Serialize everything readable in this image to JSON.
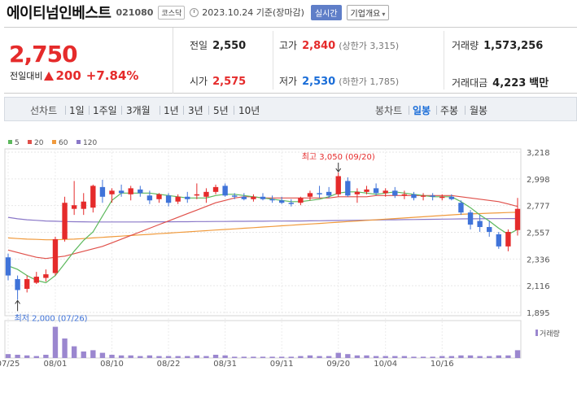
{
  "header": {
    "stock_name": "에이티넘인베스트",
    "stock_code": "021080",
    "market_badge": "코스닥",
    "base_date": "2023.10.24 기준(장마감)",
    "realtime_button": "실시간",
    "company_menu": "기업개요",
    "company_menu_caret": "▾"
  },
  "summary": {
    "price": "2,750",
    "change_label": "전일대비",
    "change_value": "200",
    "change_percent": "+7.84%",
    "prev_close_label": "전일",
    "prev_close": "2,550",
    "open_label": "시가",
    "open": "2,575",
    "high_label": "고가",
    "high": "2,840",
    "upper_limit": "(상한가 3,315)",
    "low_label": "저가",
    "low": "2,530",
    "lower_limit": "(하한가 1,785)",
    "volume_label": "거래량",
    "volume": "1,573,256",
    "amount_label": "거래대금",
    "amount": "4,223",
    "amount_unit": "백만",
    "up_color": "#e52b2b",
    "down_color": "#1a6dd8"
  },
  "toolbar": {
    "line_label": "선차트",
    "line_periods": [
      "1일",
      "1주일",
      "3개월",
      "1년",
      "3년",
      "5년",
      "10년"
    ],
    "candle_label": "봉차트",
    "candle_periods": [
      "일봉",
      "주봉",
      "월봉"
    ],
    "active_candle": "일봉"
  },
  "chart_data": {
    "type": "candlestick",
    "y_ticks": [
      "3,218",
      "2,998",
      "2,777",
      "2,557",
      "2,336",
      "2,116",
      "1,895"
    ],
    "ylim": [
      1895,
      3218
    ],
    "x_ticks": [
      {
        "i": 0,
        "label": "07/25"
      },
      {
        "i": 5,
        "label": "08/01"
      },
      {
        "i": 11,
        "label": "08/10"
      },
      {
        "i": 17,
        "label": "08/22"
      },
      {
        "i": 23,
        "label": "08/31"
      },
      {
        "i": 29,
        "label": "09/11"
      },
      {
        "i": 35,
        "label": "09/20"
      },
      {
        "i": 40,
        "label": "10/04"
      },
      {
        "i": 46,
        "label": "10/16"
      }
    ],
    "legend": [
      {
        "name": "5",
        "color": "#5cb85c"
      },
      {
        "name": "20",
        "color": "#e0504a"
      },
      {
        "name": "60",
        "color": "#f09a3c"
      },
      {
        "name": "120",
        "color": "#8a78c8"
      }
    ],
    "volume_label": "거래량",
    "high_annotation": "최고 3,050 (09/20)",
    "low_annotation": "최저 2,000 (07/26)",
    "up_color": "#e52b2b",
    "down_color": "#3f73d9",
    "volume_color": "#9b87cf",
    "candles": [
      {
        "o": 2350,
        "h": 2380,
        "l": 2160,
        "c": 2200,
        "v": 6
      },
      {
        "o": 2170,
        "h": 2200,
        "l": 2000,
        "c": 2080,
        "v": 5
      },
      {
        "o": 2090,
        "h": 2200,
        "l": 2060,
        "c": 2170,
        "v": 4
      },
      {
        "o": 2140,
        "h": 2230,
        "l": 2130,
        "c": 2190,
        "v": 3
      },
      {
        "o": 2180,
        "h": 2250,
        "l": 2150,
        "c": 2210,
        "v": 5
      },
      {
        "o": 2220,
        "h": 2520,
        "l": 2200,
        "c": 2500,
        "v": 48
      },
      {
        "o": 2500,
        "h": 2850,
        "l": 2480,
        "c": 2800,
        "v": 30
      },
      {
        "o": 2750,
        "h": 2980,
        "l": 2700,
        "c": 2780,
        "v": 18
      },
      {
        "o": 2750,
        "h": 2880,
        "l": 2700,
        "c": 2810,
        "v": 10
      },
      {
        "o": 2760,
        "h": 2950,
        "l": 2720,
        "c": 2940,
        "v": 12
      },
      {
        "o": 2930,
        "h": 2990,
        "l": 2800,
        "c": 2850,
        "v": 8
      },
      {
        "o": 2870,
        "h": 2920,
        "l": 2800,
        "c": 2900,
        "v": 5
      },
      {
        "o": 2900,
        "h": 2950,
        "l": 2850,
        "c": 2880,
        "v": 4
      },
      {
        "o": 2870,
        "h": 2940,
        "l": 2820,
        "c": 2920,
        "v": 4
      },
      {
        "o": 2910,
        "h": 2940,
        "l": 2850,
        "c": 2880,
        "v": 3
      },
      {
        "o": 2860,
        "h": 2900,
        "l": 2790,
        "c": 2820,
        "v": 4
      },
      {
        "o": 2830,
        "h": 2880,
        "l": 2800,
        "c": 2870,
        "v": 3
      },
      {
        "o": 2860,
        "h": 2880,
        "l": 2770,
        "c": 2800,
        "v": 3
      },
      {
        "o": 2810,
        "h": 2870,
        "l": 2790,
        "c": 2850,
        "v": 3
      },
      {
        "o": 2850,
        "h": 2890,
        "l": 2800,
        "c": 2830,
        "v": 3
      },
      {
        "o": 2860,
        "h": 2960,
        "l": 2830,
        "c": 2870,
        "v": 4
      },
      {
        "o": 2850,
        "h": 2920,
        "l": 2800,
        "c": 2890,
        "v": 3
      },
      {
        "o": 2890,
        "h": 2950,
        "l": 2870,
        "c": 2930,
        "v": 5
      },
      {
        "o": 2940,
        "h": 2960,
        "l": 2850,
        "c": 2860,
        "v": 4
      },
      {
        "o": 2860,
        "h": 2880,
        "l": 2830,
        "c": 2850,
        "v": 2
      },
      {
        "o": 2850,
        "h": 2880,
        "l": 2820,
        "c": 2830,
        "v": 2
      },
      {
        "o": 2830,
        "h": 2870,
        "l": 2810,
        "c": 2850,
        "v": 2
      },
      {
        "o": 2850,
        "h": 2880,
        "l": 2820,
        "c": 2830,
        "v": 2
      },
      {
        "o": 2830,
        "h": 2860,
        "l": 2800,
        "c": 2820,
        "v": 2
      },
      {
        "o": 2820,
        "h": 2850,
        "l": 2790,
        "c": 2800,
        "v": 2
      },
      {
        "o": 2800,
        "h": 2830,
        "l": 2770,
        "c": 2790,
        "v": 2
      },
      {
        "o": 2800,
        "h": 2850,
        "l": 2780,
        "c": 2840,
        "v": 3
      },
      {
        "o": 2850,
        "h": 2900,
        "l": 2820,
        "c": 2880,
        "v": 4
      },
      {
        "o": 2880,
        "h": 2940,
        "l": 2840,
        "c": 2870,
        "v": 3
      },
      {
        "o": 2890,
        "h": 2930,
        "l": 2840,
        "c": 2860,
        "v": 3
      },
      {
        "o": 2870,
        "h": 3050,
        "l": 2850,
        "c": 3020,
        "v": 8
      },
      {
        "o": 2980,
        "h": 3010,
        "l": 2850,
        "c": 2860,
        "v": 6
      },
      {
        "o": 2870,
        "h": 2920,
        "l": 2800,
        "c": 2890,
        "v": 4
      },
      {
        "o": 2890,
        "h": 2940,
        "l": 2870,
        "c": 2910,
        "v": 4
      },
      {
        "o": 2920,
        "h": 2960,
        "l": 2860,
        "c": 2880,
        "v": 3
      },
      {
        "o": 2880,
        "h": 2920,
        "l": 2850,
        "c": 2900,
        "v": 3
      },
      {
        "o": 2900,
        "h": 2930,
        "l": 2840,
        "c": 2860,
        "v": 3
      },
      {
        "o": 2860,
        "h": 2900,
        "l": 2830,
        "c": 2870,
        "v": 3
      },
      {
        "o": 2870,
        "h": 2890,
        "l": 2820,
        "c": 2840,
        "v": 2
      },
      {
        "o": 2850,
        "h": 2880,
        "l": 2820,
        "c": 2860,
        "v": 2
      },
      {
        "o": 2860,
        "h": 2880,
        "l": 2820,
        "c": 2850,
        "v": 2
      },
      {
        "o": 2840,
        "h": 2870,
        "l": 2820,
        "c": 2850,
        "v": 3
      },
      {
        "o": 2850,
        "h": 2870,
        "l": 2820,
        "c": 2830,
        "v": 3
      },
      {
        "o": 2800,
        "h": 2820,
        "l": 2700,
        "c": 2720,
        "v": 4
      },
      {
        "o": 2720,
        "h": 2740,
        "l": 2580,
        "c": 2620,
        "v": 4
      },
      {
        "o": 2650,
        "h": 2700,
        "l": 2560,
        "c": 2600,
        "v": 3
      },
      {
        "o": 2600,
        "h": 2650,
        "l": 2520,
        "c": 2560,
        "v": 3
      },
      {
        "o": 2540,
        "h": 2560,
        "l": 2420,
        "c": 2440,
        "v": 4
      },
      {
        "o": 2440,
        "h": 2580,
        "l": 2400,
        "c": 2560,
        "v": 4
      },
      {
        "o": 2575,
        "h": 2840,
        "l": 2530,
        "c": 2750,
        "v": 12
      }
    ],
    "ma5": [
      2280,
      2250,
      2200,
      2160,
      2140,
      2200,
      2300,
      2400,
      2490,
      2560,
      2690,
      2820,
      2880,
      2880,
      2880,
      2880,
      2870,
      2860,
      2850,
      2840,
      2840,
      2840,
      2860,
      2870,
      2870,
      2860,
      2850,
      2840,
      2830,
      2820,
      2810,
      2810,
      2820,
      2830,
      2850,
      2880,
      2890,
      2890,
      2880,
      2870,
      2880,
      2890,
      2880,
      2870,
      2860,
      2850,
      2850,
      2850,
      2810,
      2760,
      2700,
      2650,
      2590,
      2540,
      2580
    ],
    "ma20": [
      2410,
      2390,
      2370,
      2350,
      2340,
      2350,
      2360,
      2380,
      2400,
      2420,
      2440,
      2470,
      2500,
      2530,
      2560,
      2590,
      2620,
      2650,
      2680,
      2710,
      2740,
      2770,
      2800,
      2820,
      2840,
      2850,
      2850,
      2840,
      2840,
      2840,
      2840,
      2840,
      2840,
      2840,
      2840,
      2850,
      2850,
      2850,
      2850,
      2860,
      2860,
      2860,
      2860,
      2860,
      2860,
      2860,
      2860,
      2860,
      2850,
      2840,
      2830,
      2820,
      2810,
      2790,
      2770
    ],
    "ma60": [
      2510,
      2505,
      2500,
      2498,
      2495,
      2495,
      2498,
      2500,
      2505,
      2510,
      2515,
      2520,
      2525,
      2530,
      2535,
      2540,
      2545,
      2550,
      2555,
      2560,
      2565,
      2570,
      2575,
      2580,
      2585,
      2590,
      2595,
      2600,
      2605,
      2610,
      2615,
      2620,
      2625,
      2630,
      2635,
      2640,
      2645,
      2650,
      2655,
      2660,
      2665,
      2670,
      2675,
      2680,
      2685,
      2690,
      2695,
      2700,
      2705,
      2708,
      2711,
      2714,
      2717,
      2720,
      2722
    ],
    "ma120": [
      2680,
      2668,
      2660,
      2655,
      2650,
      2648,
      2645,
      2644,
      2643,
      2642,
      2642,
      2642,
      2642,
      2642,
      2642,
      2643,
      2643,
      2643,
      2644,
      2644,
      2645,
      2645,
      2646,
      2646,
      2647,
      2647,
      2648,
      2648,
      2649,
      2649,
      2650,
      2650,
      2651,
      2652,
      2653,
      2654,
      2655,
      2656,
      2657,
      2658,
      2659,
      2660,
      2661,
      2662,
      2663,
      2664,
      2665,
      2666,
      2667,
      2668,
      2668,
      2669,
      2669,
      2670,
      2670
    ]
  }
}
